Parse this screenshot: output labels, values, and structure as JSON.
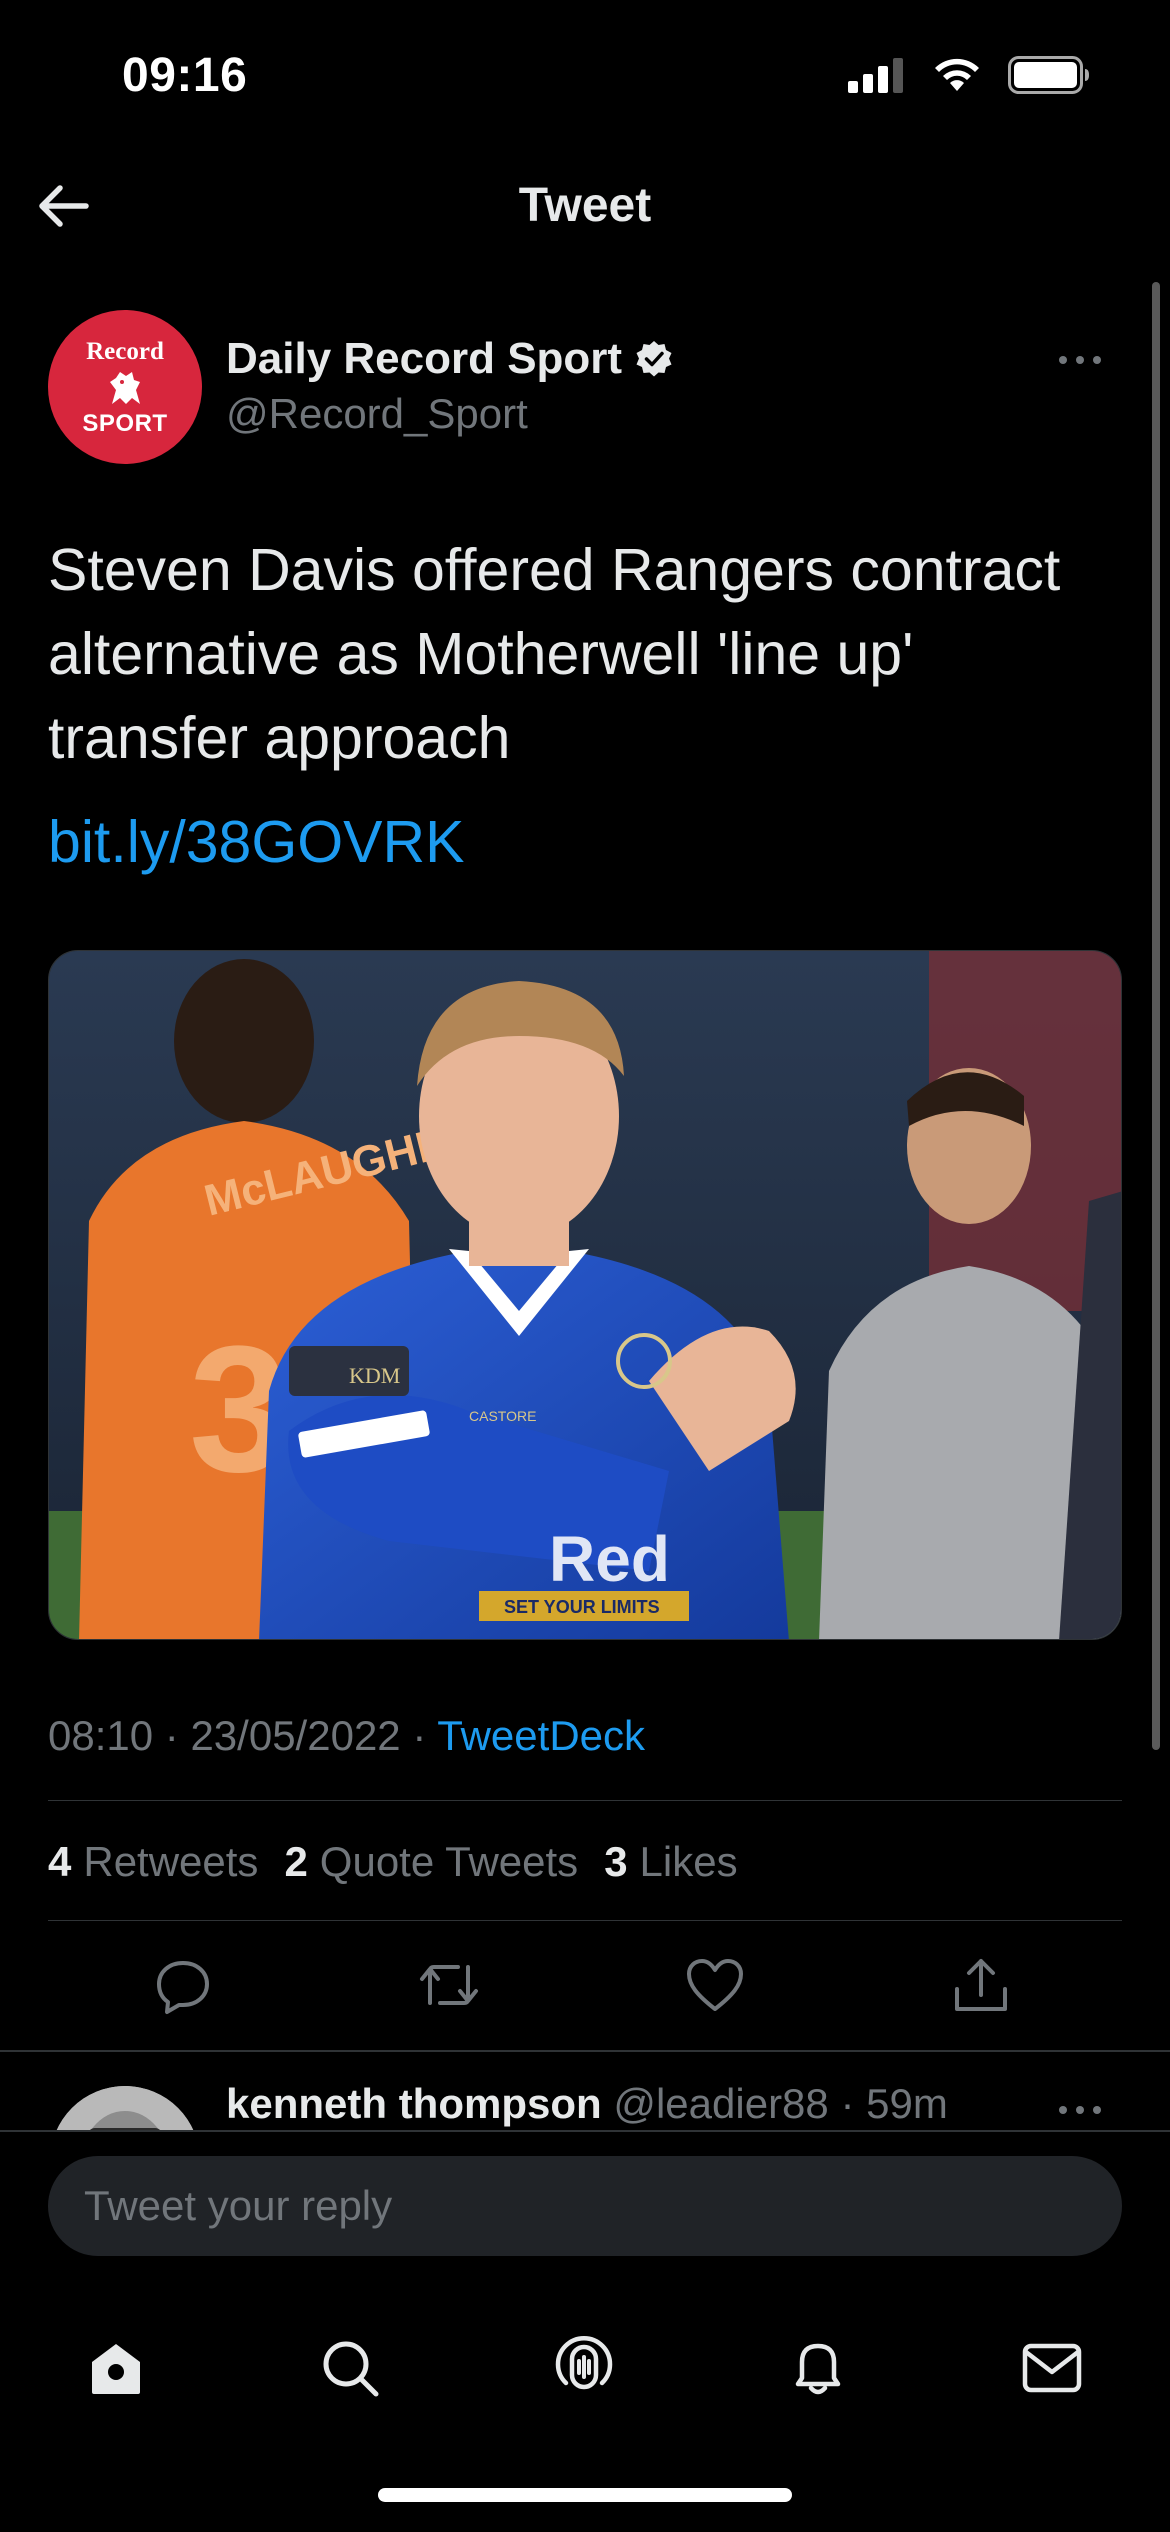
{
  "status_bar": {
    "time": "09:16"
  },
  "header": {
    "title": "Tweet"
  },
  "tweet": {
    "author": {
      "name": "Daily Record Sport",
      "handle": "@Record_Sport",
      "verified": true,
      "avatar_top_text": "Record",
      "avatar_bottom_text": "SPORT"
    },
    "text": "Steven Davis offered Rangers contract alternative as Motherwell 'line up' transfer approach",
    "link": "bit.ly/38GOVRK",
    "time": "08:10",
    "date": "23/05/2022",
    "source": "TweetDeck",
    "separator": "·",
    "stats": {
      "retweets_count": "4",
      "retweets_label": "Retweets",
      "quotes_count": "2",
      "quotes_label": "Quote Tweets",
      "likes_count": "3",
      "likes_label": "Likes"
    },
    "photo_text": {
      "sponsor_1": "KDM",
      "sponsor_2": "SET YOUR LIMITS",
      "back_name": "McLAUGHLIN",
      "back_number": "3",
      "kit_brand": "CASTORE",
      "shirt_sponsor": "Red"
    }
  },
  "reply_preview": {
    "name": "kenneth thompson",
    "handle": "@leadier88",
    "separator": "·",
    "time": "59m"
  },
  "composer": {
    "placeholder": "Tweet your reply"
  },
  "colors": {
    "background": "#000000",
    "text_primary": "#e7e9ea",
    "text_secondary": "#71767b",
    "accent": "#1d9bf0",
    "avatar_red": "#d7263d"
  }
}
